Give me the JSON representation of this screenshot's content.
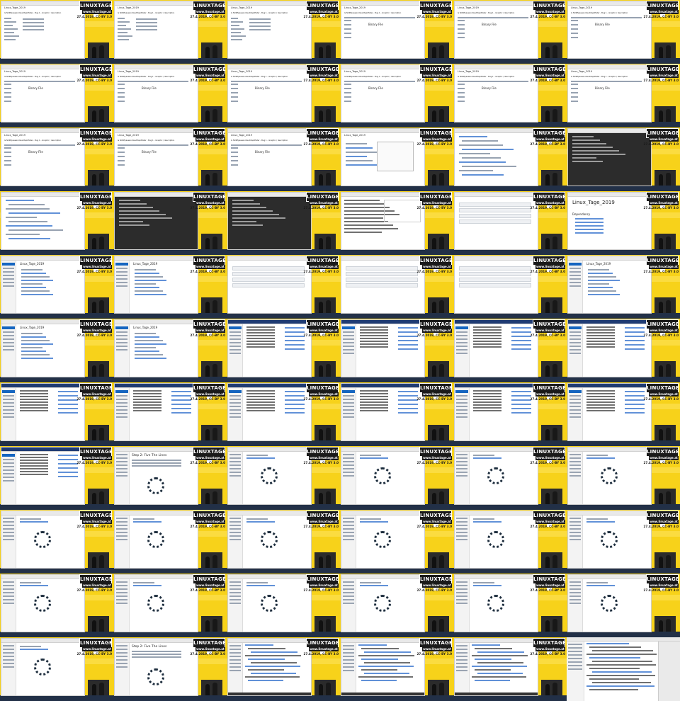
{
  "grid": {
    "columns": 6,
    "rows": 11
  },
  "overlay": {
    "logo_text": "LINUXTAGE",
    "url_text": "www.linuxtage.at",
    "license_text": "27.4.2019, CC-BY 3.0"
  },
  "screen_texts": {
    "page_title": "Linux_Tage_2019",
    "heading_large": "Linux_Tage_2019",
    "breadcrumb": "Is NUKEpasswordauditapiPlater - Bug 1 - Graphic / description",
    "binary_file": "Binary File",
    "section_heading": "Dependancy",
    "play_title": "Step 2: Five The Lines"
  },
  "tiles": [
    {
      "v": "wiki"
    },
    {
      "v": "wiki"
    },
    {
      "v": "wiki"
    },
    {
      "v": "binary"
    },
    {
      "v": "binary"
    },
    {
      "v": "binary"
    },
    {
      "v": "binary"
    },
    {
      "v": "binary"
    },
    {
      "v": "binary"
    },
    {
      "v": "binary"
    },
    {
      "v": "binary"
    },
    {
      "v": "binary"
    },
    {
      "v": "binary"
    },
    {
      "v": "binary"
    },
    {
      "v": "binary"
    },
    {
      "v": "modal"
    },
    {
      "v": "page"
    },
    {
      "v": "dark"
    },
    {
      "v": "page"
    },
    {
      "v": "darkpanel"
    },
    {
      "v": "darkpanel"
    },
    {
      "v": "editor"
    },
    {
      "v": "table"
    },
    {
      "v": "heading"
    },
    {
      "v": "sidebar-doc"
    },
    {
      "v": "sidebar-doc"
    },
    {
      "v": "table"
    },
    {
      "v": "table"
    },
    {
      "v": "table"
    },
    {
      "v": "sidebar-doc"
    },
    {
      "v": "list-doc"
    },
    {
      "v": "sidebar-list"
    },
    {
      "v": "blue-list"
    },
    {
      "v": "blue-list"
    },
    {
      "v": "blue-list"
    },
    {
      "v": "blue-list"
    },
    {
      "v": "blue-list"
    },
    {
      "v": "blue-list"
    },
    {
      "v": "blue-list"
    },
    {
      "v": "blue-list"
    },
    {
      "v": "blue-list"
    },
    {
      "v": "blue-list"
    },
    {
      "v": "blue-list"
    },
    {
      "v": "play"
    },
    {
      "v": "ring"
    },
    {
      "v": "ring"
    },
    {
      "v": "ring"
    },
    {
      "v": "ring"
    },
    {
      "v": "ring"
    },
    {
      "v": "ring"
    },
    {
      "v": "ring"
    },
    {
      "v": "ring"
    },
    {
      "v": "ring"
    },
    {
      "v": "ring"
    },
    {
      "v": "ring"
    },
    {
      "v": "ring"
    },
    {
      "v": "ring"
    },
    {
      "v": "ring"
    },
    {
      "v": "ring"
    },
    {
      "v": "ring"
    },
    {
      "v": "ring"
    },
    {
      "v": "play"
    },
    {
      "v": "code"
    },
    {
      "v": "code"
    },
    {
      "v": "code"
    },
    {
      "v": "final"
    }
  ]
}
